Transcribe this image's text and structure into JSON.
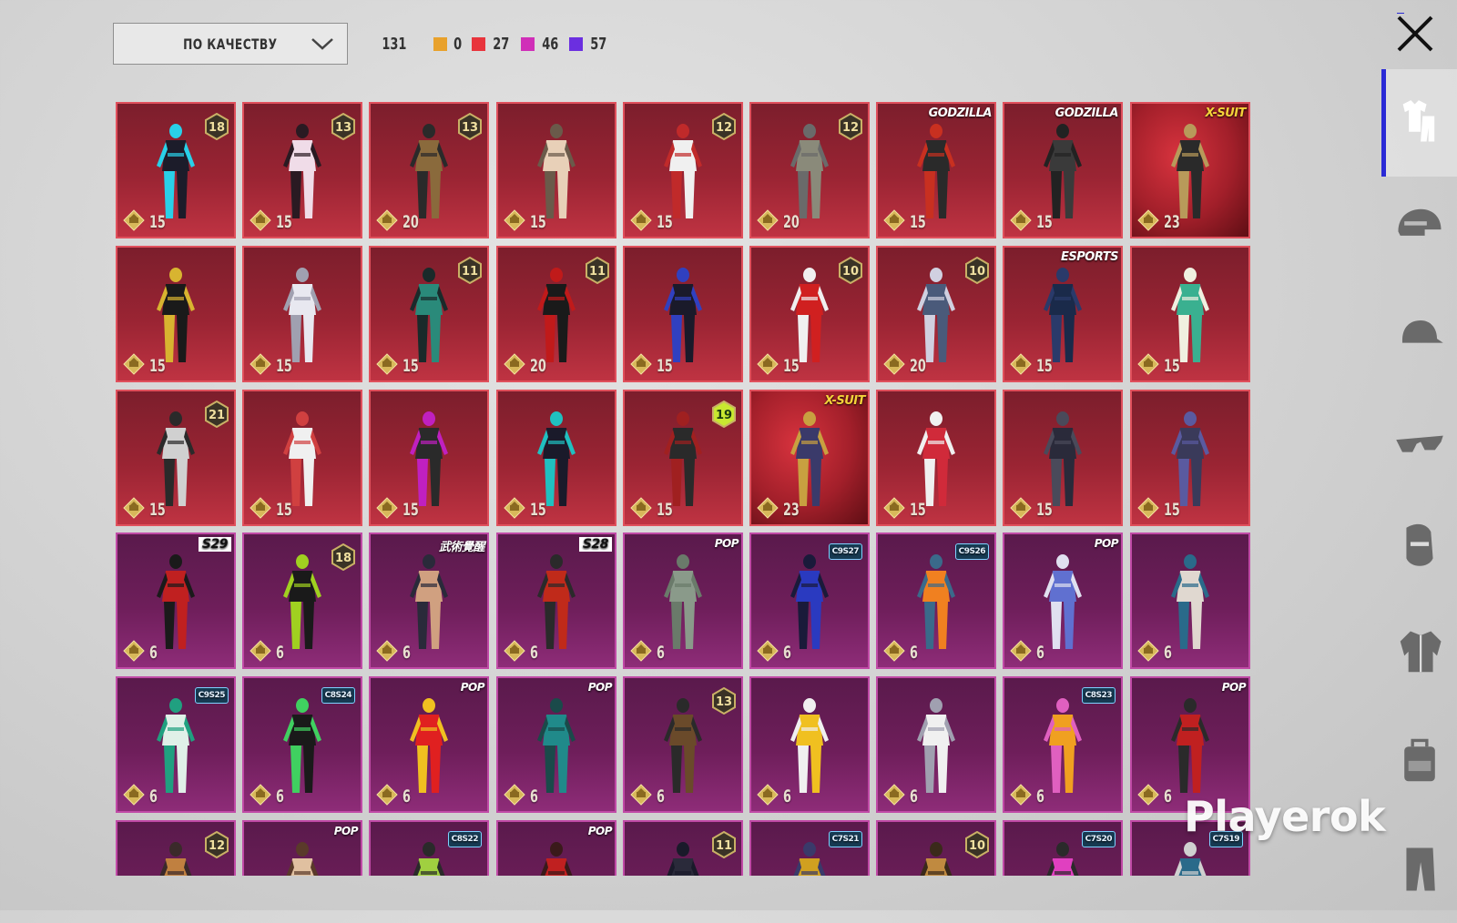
{
  "toolbar": {
    "sort_label": "ПО КАЧЕСТВУ",
    "total": "131",
    "quality_counts": [
      {
        "color": "#e8a12c",
        "count": "0"
      },
      {
        "color": "#e8343c",
        "count": "27"
      },
      {
        "color": "#d02fb8",
        "count": "46"
      },
      {
        "color": "#6b2fe0",
        "count": "57"
      }
    ]
  },
  "sidebar": {
    "items": [
      {
        "icon": "outfit-icon",
        "active": true
      },
      {
        "icon": "helmet-icon",
        "active": false
      },
      {
        "icon": "cap-icon",
        "active": false
      },
      {
        "icon": "glasses-icon",
        "active": false
      },
      {
        "icon": "mask-icon",
        "active": false
      },
      {
        "icon": "jacket-icon",
        "active": false
      },
      {
        "icon": "backpack-icon",
        "active": false
      },
      {
        "icon": "pants-icon",
        "active": false
      }
    ]
  },
  "colors": {
    "red_card": "#a22634",
    "purple_card": "#6e1e5a",
    "accent_blue": "#2a2ad6"
  },
  "items": [
    {
      "rarity": "red",
      "cost": "15",
      "level": "18",
      "colors": [
        "#1c1c2a",
        "#29d0e8"
      ]
    },
    {
      "rarity": "red",
      "cost": "15",
      "level": "13",
      "colors": [
        "#f0dce8",
        "#2a1a22"
      ]
    },
    {
      "rarity": "red",
      "cost": "20",
      "level": "13",
      "colors": [
        "#8a6a3c",
        "#2a2a2a"
      ]
    },
    {
      "rarity": "red",
      "cost": "15",
      "colors": [
        "#e8d0b8",
        "#6a5a4a"
      ]
    },
    {
      "rarity": "red",
      "cost": "15",
      "level": "12",
      "colors": [
        "#f0f0f0",
        "#c02a2a"
      ]
    },
    {
      "rarity": "red",
      "cost": "20",
      "level": "12",
      "colors": [
        "#8a8a7a",
        "#6a6a6a"
      ]
    },
    {
      "rarity": "red",
      "cost": "15",
      "tag": "GODZILLA",
      "colors": [
        "#2a2a2a",
        "#c83020"
      ]
    },
    {
      "rarity": "red",
      "cost": "15",
      "tag": "GODZILLA",
      "colors": [
        "#3a3a3a",
        "#222222"
      ]
    },
    {
      "rarity": "red",
      "cost": "23",
      "tag": "X-SUIT",
      "xsuit": true,
      "colors": [
        "#2a2a2a",
        "#b89a5a"
      ]
    },
    {
      "rarity": "red",
      "cost": "15",
      "colors": [
        "#1a1a1a",
        "#d8b430"
      ]
    },
    {
      "rarity": "red",
      "cost": "15",
      "colors": [
        "#e8e8f0",
        "#a0a0b0"
      ]
    },
    {
      "rarity": "red",
      "cost": "15",
      "level": "11",
      "colors": [
        "#2a8a7a",
        "#1a2a2a"
      ]
    },
    {
      "rarity": "red",
      "cost": "20",
      "level": "11",
      "colors": [
        "#1a1a1a",
        "#c01a1a"
      ]
    },
    {
      "rarity": "red",
      "cost": "15",
      "colors": [
        "#1a1a2a",
        "#3040c0"
      ]
    },
    {
      "rarity": "red",
      "cost": "15",
      "level": "10",
      "colors": [
        "#d02020",
        "#f0f0f0"
      ]
    },
    {
      "rarity": "red",
      "cost": "20",
      "level": "10",
      "colors": [
        "#4a5a7a",
        "#d0d0e0"
      ]
    },
    {
      "rarity": "red",
      "cost": "15",
      "tag": "ESPORTS",
      "colors": [
        "#1a2a4a",
        "#2a3a6a"
      ]
    },
    {
      "rarity": "red",
      "cost": "15",
      "colors": [
        "#3ab090",
        "#f0f0e0"
      ]
    },
    {
      "rarity": "red",
      "cost": "15",
      "level": "21",
      "colors": [
        "#d0d0d0",
        "#2a2a2a"
      ]
    },
    {
      "rarity": "red",
      "cost": "15",
      "colors": [
        "#f0f0f0",
        "#d04040"
      ]
    },
    {
      "rarity": "red",
      "cost": "15",
      "colors": [
        "#2a2a2a",
        "#c020c0"
      ]
    },
    {
      "rarity": "red",
      "cost": "15",
      "colors": [
        "#1a1a2a",
        "#20c0c0"
      ]
    },
    {
      "rarity": "red",
      "cost": "15",
      "level": "19",
      "colors": [
        "#2a2a2a",
        "#a02020"
      ]
    },
    {
      "rarity": "red",
      "cost": "23",
      "tag": "X-SUIT",
      "xsuit": true,
      "colors": [
        "#3a3a6a",
        "#c8a040"
      ]
    },
    {
      "rarity": "red",
      "cost": "15",
      "colors": [
        "#d02a3a",
        "#f0f0f0"
      ]
    },
    {
      "rarity": "red",
      "cost": "15",
      "colors": [
        "#2a2a3a",
        "#4a4a5a"
      ]
    },
    {
      "rarity": "red",
      "cost": "15",
      "colors": [
        "#3a3a5a",
        "#5a5aa0"
      ]
    },
    {
      "rarity": "purple",
      "cost": "6",
      "tag": "S29",
      "tag_style": "s",
      "colors": [
        "#c02020",
        "#1a1a1a"
      ]
    },
    {
      "rarity": "purple",
      "cost": "6",
      "level": "18",
      "colors": [
        "#1a1a1a",
        "#a0d020"
      ]
    },
    {
      "rarity": "purple",
      "cost": "6",
      "tag": "武術覺醒",
      "colors": [
        "#d0a080",
        "#2a2a3a"
      ]
    },
    {
      "rarity": "purple",
      "cost": "6",
      "tag": "S28",
      "tag_style": "s",
      "colors": [
        "#c02a1a",
        "#2a2a2a"
      ]
    },
    {
      "rarity": "purple",
      "cost": "6",
      "tag": "POP",
      "tag_style": "pop",
      "colors": [
        "#8a9a8a",
        "#6a7a6a"
      ]
    },
    {
      "rarity": "purple",
      "cost": "6",
      "tag": "C9S27",
      "tag_style": "season",
      "colors": [
        "#2a3ac0",
        "#1a1a3a"
      ]
    },
    {
      "rarity": "purple",
      "cost": "6",
      "tag": "C9S26",
      "tag_style": "season",
      "colors": [
        "#f08020",
        "#3a6a8a"
      ]
    },
    {
      "rarity": "purple",
      "cost": "6",
      "tag": "POP",
      "tag_style": "pop",
      "colors": [
        "#6070d0",
        "#e0e0f0"
      ]
    },
    {
      "rarity": "purple",
      "cost": "6",
      "colors": [
        "#e0d8d0",
        "#2a6a8a"
      ]
    },
    {
      "rarity": "purple",
      "cost": "6",
      "tag": "C9S25",
      "tag_style": "season",
      "colors": [
        "#e0f0e8",
        "#20a080"
      ]
    },
    {
      "rarity": "purple",
      "cost": "6",
      "tag": "C8S24",
      "tag_style": "season",
      "colors": [
        "#1a1a1a",
        "#40d060"
      ]
    },
    {
      "rarity": "purple",
      "cost": "6",
      "tag": "POP",
      "tag_style": "pop",
      "colors": [
        "#e02020",
        "#f0c020"
      ]
    },
    {
      "rarity": "purple",
      "cost": "6",
      "tag": "POP",
      "tag_style": "pop",
      "colors": [
        "#208a8a",
        "#1a4a4a"
      ]
    },
    {
      "rarity": "purple",
      "cost": "6",
      "level": "13",
      "colors": [
        "#6a4a2a",
        "#2a2a2a"
      ]
    },
    {
      "rarity": "purple",
      "cost": "6",
      "colors": [
        "#f0c020",
        "#f0f0f0"
      ]
    },
    {
      "rarity": "purple",
      "cost": "6",
      "colors": [
        "#f0f0f0",
        "#a0a0b0"
      ]
    },
    {
      "rarity": "purple",
      "cost": "6",
      "tag": "C8S23",
      "tag_style": "season",
      "colors": [
        "#f0a020",
        "#e060c0"
      ]
    },
    {
      "rarity": "purple",
      "cost": "6",
      "tag": "POP",
      "tag_style": "pop",
      "colors": [
        "#c02020",
        "#2a2a2a"
      ]
    },
    {
      "rarity": "purple",
      "cost": "",
      "level": "12",
      "colors": [
        "#c08040",
        "#3a2a2a"
      ]
    },
    {
      "rarity": "purple",
      "cost": "",
      "tag": "POP",
      "tag_style": "pop",
      "colors": [
        "#e0c0a0",
        "#5a3a2a"
      ]
    },
    {
      "rarity": "purple",
      "cost": "",
      "tag": "C8S22",
      "tag_style": "season",
      "colors": [
        "#a0d040",
        "#2a2a2a"
      ]
    },
    {
      "rarity": "purple",
      "cost": "",
      "tag": "POP",
      "tag_style": "pop",
      "colors": [
        "#c02020",
        "#3a1a1a"
      ]
    },
    {
      "rarity": "purple",
      "cost": "",
      "level": "11",
      "colors": [
        "#2a2a3a",
        "#1a1a2a"
      ]
    },
    {
      "rarity": "purple",
      "cost": "",
      "tag": "C7S21",
      "tag_style": "season",
      "colors": [
        "#d0a020",
        "#3a3a6a"
      ]
    },
    {
      "rarity": "purple",
      "cost": "",
      "level": "10",
      "colors": [
        "#c08a40",
        "#3a2a1a"
      ]
    },
    {
      "rarity": "purple",
      "cost": "",
      "tag": "C7S20",
      "tag_style": "season",
      "colors": [
        "#e040c0",
        "#2a2a2a"
      ]
    },
    {
      "rarity": "purple",
      "cost": "",
      "tag": "C7S19",
      "tag_style": "season",
      "colors": [
        "#2a6a8a",
        "#d0d0d0"
      ]
    }
  ],
  "watermark": "Playerok"
}
